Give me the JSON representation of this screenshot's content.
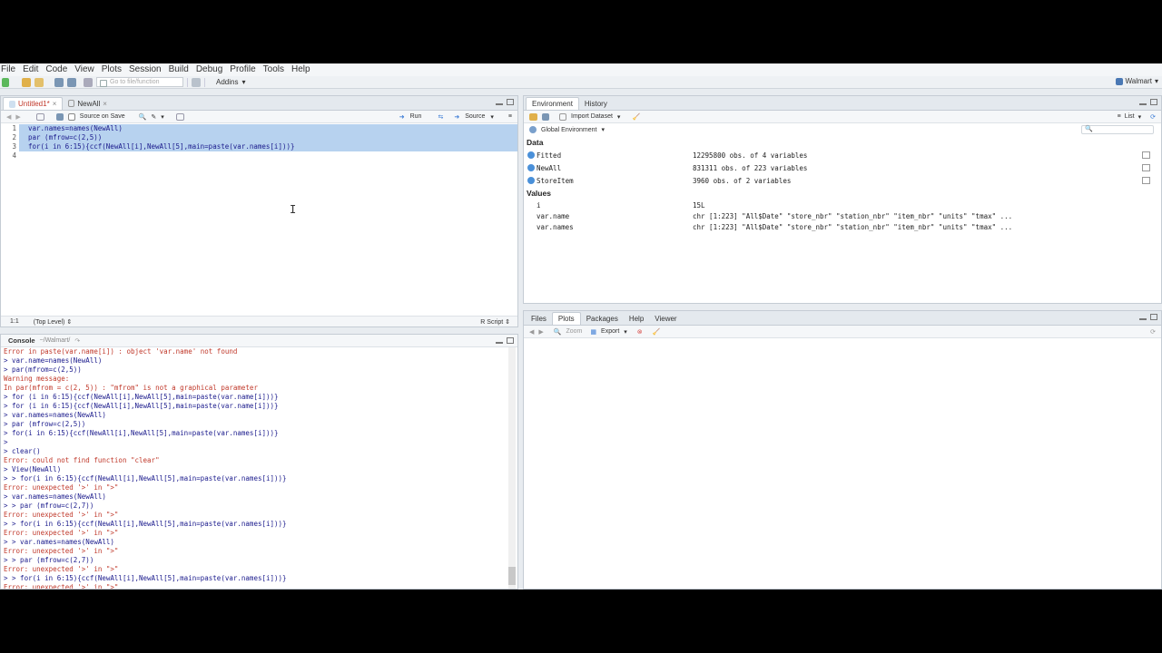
{
  "menu": [
    "File",
    "Edit",
    "Code",
    "View",
    "Plots",
    "Session",
    "Build",
    "Debug",
    "Profile",
    "Tools",
    "Help"
  ],
  "toolbar": {
    "goto_placeholder": "Go to file/function",
    "addins_label": "Addins",
    "project_label": "Walmart"
  },
  "editor": {
    "tabs": [
      {
        "label": "Untitled1*",
        "active": true
      },
      {
        "label": "NewAll",
        "active": false
      }
    ],
    "source_on_save": "Source on Save",
    "run_label": "Run",
    "source_label": "Source",
    "lines": [
      {
        "num": "1",
        "text": "var.names=names(NewAll)"
      },
      {
        "num": "2",
        "text": "par (mfrow=c(2,5))"
      },
      {
        "num": "3",
        "text": "for(i in 6:15){ccf(NewAll[i],NewAll[5],main=paste(var.names[i]))}"
      },
      {
        "num": "4",
        "text": ""
      }
    ],
    "status_position": "1:1",
    "status_scope": "(Top Level)",
    "status_type": "R Script"
  },
  "console": {
    "title": "Console",
    "path": "~/Walmart/",
    "lines": [
      {
        "t": "err",
        "text": "Error in paste(var.name[i]) : object 'var.name' not found"
      },
      {
        "t": "cmd",
        "text": "> var.name=names(NewAll)"
      },
      {
        "t": "cmd",
        "text": "> par(mfrom=c(2,5))"
      },
      {
        "t": "err",
        "text": "Warning message:"
      },
      {
        "t": "err",
        "text": "In par(mfrom = c(2, 5)) : \"mfrom\" is not a graphical parameter"
      },
      {
        "t": "cmd",
        "text": "> for (i in 6:15){ccf(NewAll[i],NewAll[5],main=paste(var.name[i]))}"
      },
      {
        "t": "cmd",
        "text": "> for (i in 6:15){ccf(NewAll[i],NewAll[5],main=paste(var.name[i]))}"
      },
      {
        "t": "cmd",
        "text": "> var.names=names(NewAll)"
      },
      {
        "t": "cmd",
        "text": "> par (mfrow=c(2,5))"
      },
      {
        "t": "cmd",
        "text": "> for(i in 6:15){ccf(NewAll[i],NewAll[5],main=paste(var.names[i]))}"
      },
      {
        "t": "cmd",
        "text": ">"
      },
      {
        "t": "cmd",
        "text": "> clear()"
      },
      {
        "t": "err",
        "text": "Error: could not find function \"clear\""
      },
      {
        "t": "cmd",
        "text": "> View(NewAll)"
      },
      {
        "t": "cmd",
        "text": "> > for(i in 6:15){ccf(NewAll[i],NewAll[5],main=paste(var.names[i]))}"
      },
      {
        "t": "err",
        "text": "Error: unexpected '>' in \">\""
      },
      {
        "t": "cmd",
        "text": "> var.names=names(NewAll)"
      },
      {
        "t": "cmd",
        "text": "> > par (mfrow=c(2,7))"
      },
      {
        "t": "err",
        "text": "Error: unexpected '>' in \">\""
      },
      {
        "t": "cmd",
        "text": "> > for(i in 6:15){ccf(NewAll[i],NewAll[5],main=paste(var.names[i]))}"
      },
      {
        "t": "err",
        "text": "Error: unexpected '>' in \">\""
      },
      {
        "t": "cmd",
        "text": "> > var.names=names(NewAll)"
      },
      {
        "t": "err",
        "text": "Error: unexpected '>' in \">\""
      },
      {
        "t": "cmd",
        "text": "> > par (mfrow=c(2,7))"
      },
      {
        "t": "err",
        "text": "Error: unexpected '>' in \">\""
      },
      {
        "t": "cmd",
        "text": "> > for(i in 6:15){ccf(NewAll[i],NewAll[5],main=paste(var.names[i]))}"
      },
      {
        "t": "err",
        "text": "Error: unexpected '>' in \">\""
      }
    ]
  },
  "environment": {
    "tabs": [
      "Environment",
      "History"
    ],
    "import_label": "Import Dataset",
    "list_label": "List",
    "scope_label": "Global Environment",
    "data_heading": "Data",
    "data": [
      {
        "name": "Fitted",
        "value": "12295800 obs. of 4 variables"
      },
      {
        "name": "NewAll",
        "value": "831311 obs. of 223 variables"
      },
      {
        "name": "StoreItem",
        "value": "3960 obs. of 2 variables"
      }
    ],
    "values_heading": "Values",
    "values": [
      {
        "name": "i",
        "value": "15L"
      },
      {
        "name": "var.name",
        "value": "chr [1:223] \"All$Date\" \"store_nbr\" \"station_nbr\" \"item_nbr\" \"units\" \"tmax\" ..."
      },
      {
        "name": "var.names",
        "value": "chr [1:223] \"All$Date\" \"store_nbr\" \"station_nbr\" \"item_nbr\" \"units\" \"tmax\" ..."
      }
    ]
  },
  "files": {
    "tabs": [
      "Files",
      "Plots",
      "Packages",
      "Help",
      "Viewer"
    ],
    "active_tab": "Plots",
    "zoom_label": "Zoom",
    "export_label": "Export"
  }
}
